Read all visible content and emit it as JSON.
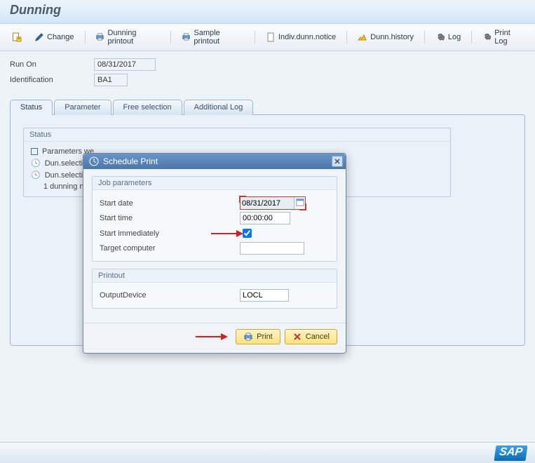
{
  "page_title": "Dunning",
  "toolbar": {
    "change": "Change",
    "dunning_printout": "Dunning printout",
    "sample_printout": "Sample printout",
    "indiv_notice": "Indiv.dunn.notice",
    "dunn_history": "Dunn.history",
    "log": "Log",
    "print_log": "Print Log"
  },
  "fields": {
    "run_on_label": "Run On",
    "run_on_value": "08/31/2017",
    "identification_label": "Identification",
    "identification_value": "BA1"
  },
  "tabs": {
    "status": "Status",
    "parameter": "Parameter",
    "free_selection": "Free selection",
    "additional_log": "Additional Log"
  },
  "status_panel": {
    "title": "Status",
    "lines": {
      "parameters": "Parameters we",
      "sel_scheduled": "Dun.selection",
      "sel_complete": "Dun.selection",
      "notice_count": "1 dunning not"
    }
  },
  "dialog": {
    "title": "Schedule Print",
    "groups": {
      "job": {
        "title": "Job parameters",
        "start_date_label": "Start date",
        "start_date_value": "08/31/2017",
        "start_time_label": "Start time",
        "start_time_value": "00:00:00",
        "start_immediately_label": "Start immediately",
        "start_immediately_checked": true,
        "target_computer_label": "Target computer",
        "target_computer_value": ""
      },
      "printout": {
        "title": "Printout",
        "output_device_label": "OutputDevice",
        "output_device_value": "LOCL"
      }
    },
    "buttons": {
      "print": "Print",
      "cancel": "Cancel"
    }
  },
  "footer": {
    "logo": "SAP"
  }
}
